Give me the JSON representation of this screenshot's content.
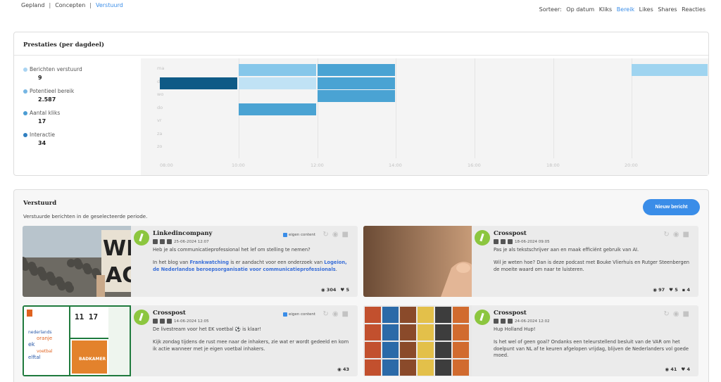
{
  "topnav": {
    "items": [
      "Gepland",
      "Concepten",
      "Verstuurd"
    ],
    "separator": "|"
  },
  "sort": {
    "label": "Sorteer:",
    "options": [
      "Op datum",
      "Kliks",
      "Bereik",
      "Likes",
      "Shares",
      "Reacties"
    ]
  },
  "performance": {
    "title": "Prestaties (per dagdeel)",
    "stats": [
      {
        "label": "Berichten verstuurd",
        "value": "9",
        "color": "#a9d4f2"
      },
      {
        "label": "Potentieel bereik",
        "value": "2.587",
        "color": "#76b6e3"
      },
      {
        "label": "Aantal kliks",
        "value": "17",
        "color": "#4b9cd3"
      },
      {
        "label": "Interactie",
        "value": "34",
        "color": "#2f7fc0"
      }
    ],
    "days": [
      "ma",
      "di",
      "wo",
      "do",
      "vr",
      "za",
      "zo"
    ],
    "hours": [
      "08:00",
      "10:00",
      "12:00",
      "14:00",
      "16:00",
      "18:00",
      "20:00"
    ]
  },
  "sent": {
    "title": "Verstuurd",
    "subtitle": "Verstuurde berichten in de geselecteerde periode.",
    "new_button": "Nieuw bericht",
    "eigen_content_label": "eigen content",
    "posts": [
      {
        "name": "Linkedincompany",
        "date": "25-06-2024 12:07",
        "eigen_content": true,
        "paragraphs": [
          [
            {
              "t": "Heb je als communicatieprofessional het lef om stelling te nemen?"
            }
          ],
          [
            {
              "t": "In het blog van "
            },
            {
              "t": "Frankwatching",
              "link": true
            },
            {
              "t": " is er aandacht voor een onderzoek van "
            },
            {
              "t": "Logeion, de Nederlandse beroepsorganisatie voor communicatieprofessionals",
              "link": true
            },
            {
              "t": "."
            }
          ]
        ],
        "stats": {
          "views": "304",
          "likes": "5"
        }
      },
      {
        "name": "Crosspost",
        "date": "18-06-2024 09:05",
        "eigen_content": false,
        "paragraphs": [
          [
            {
              "t": "Pas je als tekstschrijver aan en maak efficiënt gebruik van AI."
            }
          ],
          [
            {
              "t": "Wil je weten hoe? Dan is deze podcast met Bouke Vlierhuis en Rutger Steenbergen de moeite waard om naar te luisteren."
            }
          ]
        ],
        "stats": {
          "views": "97",
          "likes": "5",
          "comments": "4"
        }
      },
      {
        "name": "Crosspost",
        "date": "14-06-2024 12:05",
        "eigen_content": true,
        "paragraphs": [
          [
            {
              "t": "De livestream voor het EK voetbal ⚽ is klaar!"
            }
          ],
          [
            {
              "t": "Kijk zondag tijdens de rust mee naar de inhakers, zie wat er wordt gedeeld en kom ik actie wanneer met je eigen voetbal inhakers."
            }
          ]
        ],
        "stats": {
          "views": "43"
        },
        "thumb_texts": {
          "clock": "11 17",
          "room": "BADKAMER",
          "words": [
            "nederlands",
            "oranje",
            "ek",
            "voetbal",
            "elftal"
          ]
        }
      },
      {
        "name": "Crosspost",
        "date": "24-06-2024 12:02",
        "eigen_content": false,
        "paragraphs": [
          [
            {
              "t": "Hup Holland Hup!"
            }
          ],
          [
            {
              "t": "Is het wel of geen goal? Ondanks een teleurstellend besluit van de VAR om het doelpunt van NL af te keuren afgelopen vrijdag, blijven de Nederlanders vol goede moed."
            }
          ]
        ],
        "stats": {
          "views": "41",
          "likes": "4"
        }
      }
    ]
  },
  "colors": {
    "accent": "#3a8de8",
    "heat_dark": "#0e5a86",
    "heat_mid": "#4aa3d3",
    "heat_light": "#86c7ea",
    "heat_pale": "#c0e2f5"
  }
}
